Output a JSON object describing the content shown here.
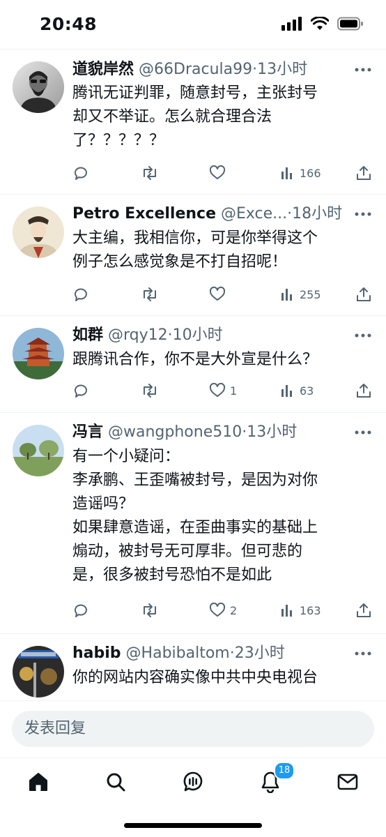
{
  "status_bar": {
    "time": "20:48"
  },
  "tweets": [
    {
      "name": "道貌岸然",
      "handle": "@66Dracula99",
      "time": "·13小时",
      "text": "腾讯无证判罪，随意封号，主张封号\n却又不举证。怎么就合理合法\n了？？？？？",
      "likes": "",
      "views": "166"
    },
    {
      "name": "Petro Excellence",
      "handle": "@Exce...",
      "time": "·18小时",
      "text": "大主编，我相信你，可是你举得这个\n例子怎么感觉象是不打自招呢！",
      "likes": "",
      "views": "255"
    },
    {
      "name": "如群",
      "handle": "@rqy12",
      "time": "·10小时",
      "text": "跟腾讯合作，你不是大外宣是什么？",
      "likes": "1",
      "views": "63"
    },
    {
      "name": "冯言",
      "handle": "@wangphone510",
      "time": "·13小时",
      "text": "有一个小疑问：\n李承鹏、王歪嘴被封号，是因为对你\n造谣吗？\n如果肆意造谣，在歪曲事实的基础上\n煽动，被封号无可厚非。但可悲的\n是，很多被封号恐怕不是如此",
      "likes": "2",
      "views": "163"
    },
    {
      "name": "habib",
      "handle": "@Habibaltom",
      "time": "·23小时",
      "text": "你的网站内容确实像中共中央电视台",
      "likes": "",
      "views": ""
    }
  ],
  "reply": {
    "placeholder": "发表回复"
  },
  "tab_bar": {
    "items": [
      "home-icon",
      "search-icon",
      "spaces-icon",
      "notifications-icon",
      "messages-icon"
    ],
    "notification_badge": "18"
  },
  "colors": {
    "accent": "#1d9bf0",
    "secondary_text": "#536471",
    "divider": "#eff3f4"
  }
}
